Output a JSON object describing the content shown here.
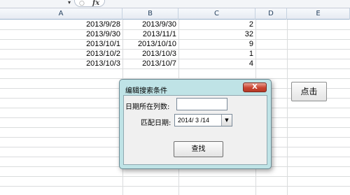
{
  "formula_bar": {
    "name_box_arrow": "▾",
    "fx_label": "fx",
    "circle": "○"
  },
  "columns": [
    "A",
    "B",
    "C",
    "D",
    "E"
  ],
  "rows": [
    {
      "a": "2013/9/28",
      "b": "2013/9/30",
      "c": "2"
    },
    {
      "a": "2013/9/30",
      "b": "2013/11/1",
      "c": "32"
    },
    {
      "a": "2013/10/1",
      "b": "2013/10/10",
      "c": "9"
    },
    {
      "a": "2013/10/2",
      "b": "2013/10/3",
      "c": "1"
    },
    {
      "a": "2013/10/3",
      "b": "2013/10/7",
      "c": "4"
    }
  ],
  "sheet_button": {
    "label": "点击"
  },
  "dialog": {
    "title": "编辑搜索条件",
    "close_label": "X",
    "column_label": "日期所在列数:",
    "column_value": "",
    "date_label": "匹配日期:",
    "date_value": "2014/ 3 /14",
    "date_drop": "▼",
    "search_label": "查找"
  },
  "colors": {
    "dialog_frame": "#bfe3e6",
    "close_button": "#c9432f",
    "grid_line": "#dadcdd"
  }
}
